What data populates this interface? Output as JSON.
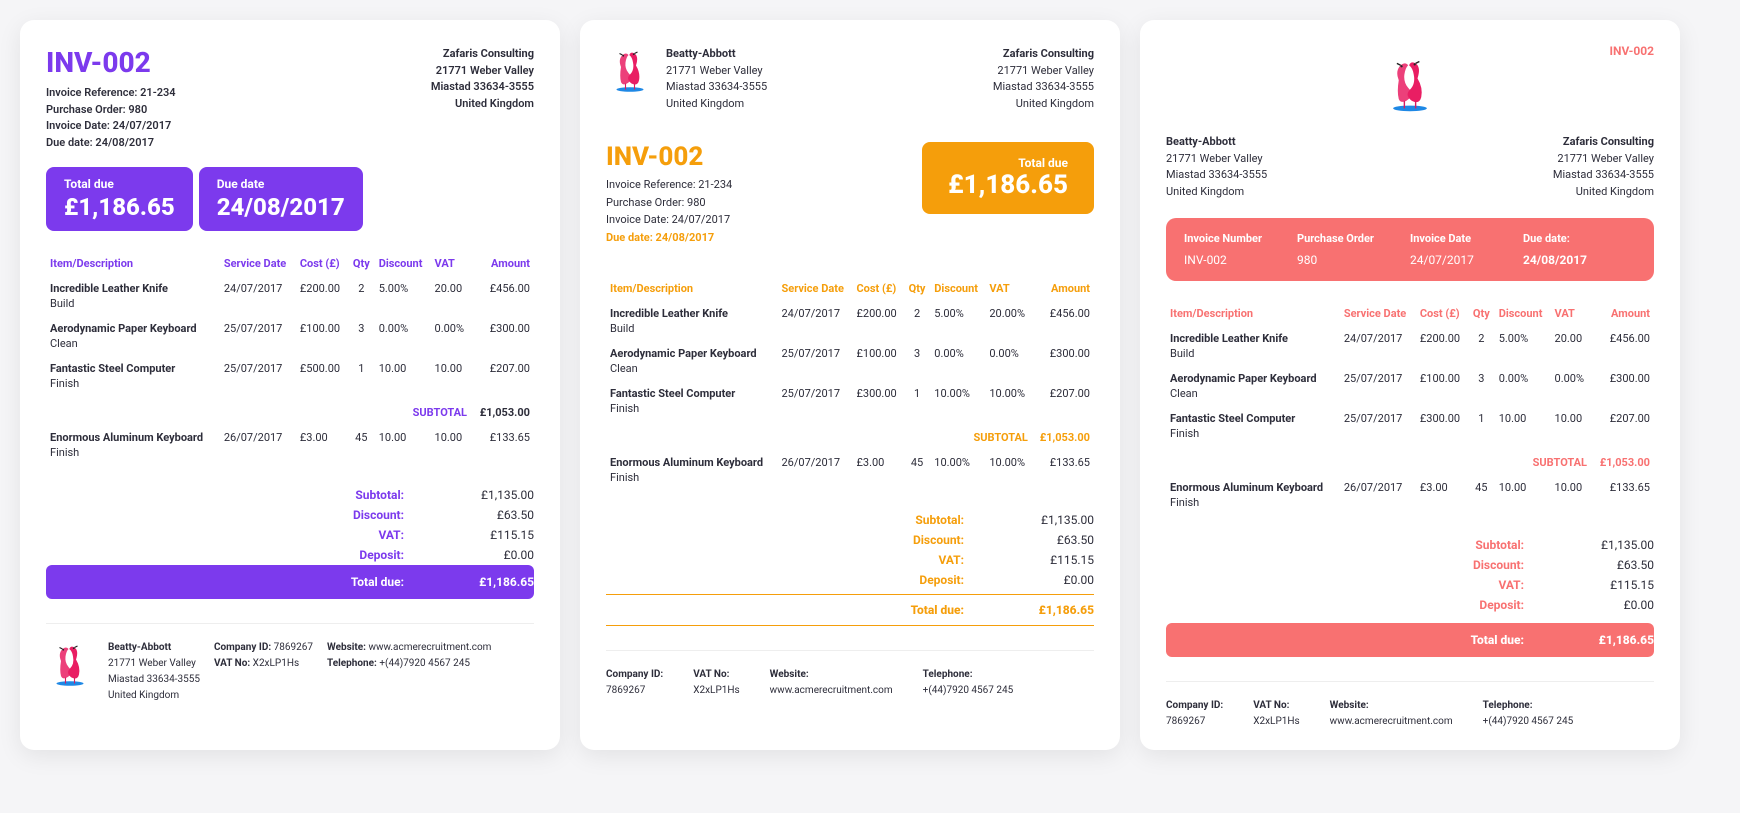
{
  "invoice_number": "INV-002",
  "reference_label": "Invoice Reference: 21-234",
  "po_label": "Purchase Order: 980",
  "date_label": "Invoice Date: 24/07/2017",
  "due_label": "Due date: 24/08/2017",
  "client": {
    "name": "Zafaris Consulting",
    "street": "21771 Weber Valley",
    "city": "Miastad 33634-3555",
    "country": "United Kingdom"
  },
  "vendor": {
    "name": "Beatty-Abbott",
    "street": "21771 Weber Valley",
    "city": "Miastad 33634-3555",
    "country": "United Kingdom"
  },
  "labels": {
    "total_due": "Total due",
    "due_date": "Due date",
    "invoice_number": "Invoice Number",
    "purchase_order": "Purchase Order",
    "invoice_date": "Invoice Date",
    "subtotal": "SUBTOTAL",
    "t_subtotal": "Subtotal:",
    "t_discount": "Discount:",
    "t_vat": "VAT:",
    "t_deposit": "Deposit:",
    "t_totaldue": "Total due:",
    "company_id": "Company ID:",
    "vat_no": "VAT No:",
    "website": "Website:",
    "telephone": "Telephone:"
  },
  "headers": {
    "item": "Item/Description",
    "service_date": "Service Date",
    "cost": "Cost (£)",
    "qty": "Qty",
    "discount": "Discount",
    "vat": "VAT",
    "amount": "Amount"
  },
  "lines": [
    {
      "desc": "Incredible Leather Knife",
      "sub": "Build",
      "date": "24/07/2017",
      "cost": "£200.00",
      "qty": "2",
      "disc": "5.00%",
      "vat": "20.00",
      "amt": "£456.00"
    },
    {
      "desc": "Aerodynamic Paper Keyboard",
      "sub": "Clean",
      "date": "25/07/2017",
      "cost": "£100.00",
      "qty": "3",
      "disc": "0.00%",
      "vat": "0.00%",
      "amt": "£300.00"
    },
    {
      "desc": "Fantastic Steel Computer",
      "sub": "Finish",
      "date": "25/07/2017",
      "cost": "£300.00",
      "qty": "1",
      "disc": "10.00",
      "vat": "10.00",
      "amt": "£207.00"
    }
  ],
  "lines_c1_override": {
    "2": {
      "cost": "£500.00"
    }
  },
  "lines_c2_vat0": "20.00%",
  "lines_c2_disc2": "10.00%",
  "lines_c2_vat2": "10.00%",
  "subtotal_first": "£1,053.00",
  "lines_after": [
    {
      "desc": "Enormous Aluminum Keyboard",
      "sub": "Finish",
      "date": "26/07/2017",
      "cost": "£3.00",
      "qty": "45",
      "disc": "10.00",
      "vat": "10.00",
      "amt": "£133.65"
    }
  ],
  "lines_after_c2": {
    "disc": "10.00%",
    "vat": "10.00%"
  },
  "totals": {
    "subtotal": "£1,135.00",
    "discount": "£63.50",
    "vat": "£115.15",
    "deposit": "£0.00",
    "due": "£1,186.65"
  },
  "band": {
    "invoice_number": "INV-002",
    "po": "980",
    "date": "24/07/2017",
    "due": "24/08/2017"
  },
  "footer": {
    "company_id": "7869267",
    "vat_no": "X2xLP1Hs",
    "website": "www.acmerecruitment.com",
    "telephone": "+(44)7920 4567 245"
  },
  "total_due_val": "£1,186.65",
  "due_date_val": "24/08/2017"
}
